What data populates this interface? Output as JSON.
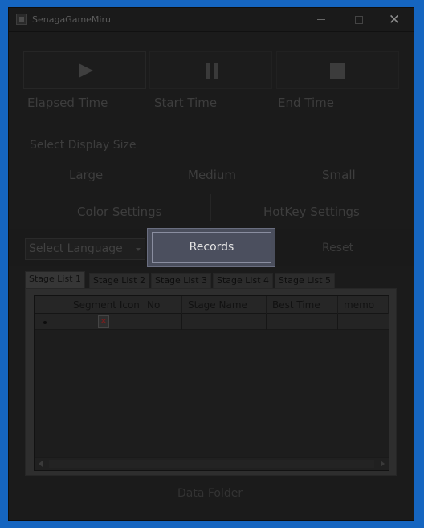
{
  "window": {
    "title": "SenagaGameMiru",
    "close_glyph": "✕"
  },
  "controls": {
    "play_icon": "play-icon",
    "pause_icon": "pause-icon",
    "stop_icon": "stop-icon"
  },
  "labels": {
    "elapsed_time": "Elapsed Time",
    "start_time": "Start Time",
    "end_time": "End Time",
    "select_display_size": "Select Display Size",
    "size_large": "Large",
    "size_medium": "Medium",
    "size_small": "Small",
    "color_settings": "Color Settings",
    "hotkey_settings": "HotKey Settings",
    "records": "Records",
    "reset": "Reset",
    "data_folder": "Data Folder"
  },
  "language": {
    "selected": "Select Language"
  },
  "tabs": [
    {
      "label": "Stage List 1",
      "active": true
    },
    {
      "label": "Stage List 2",
      "active": false
    },
    {
      "label": "Stage List 3",
      "active": false
    },
    {
      "label": "Stage List 4",
      "active": false
    },
    {
      "label": "Stage List 5",
      "active": false
    }
  ],
  "grid": {
    "columns": [
      "",
      "Segment Icon",
      "No",
      "Stage Name",
      "Best Time",
      "memo"
    ],
    "rows": [
      {
        "marker": "new-row-marker",
        "icon": "broken-image-icon",
        "no": "",
        "stage_name": "",
        "best_time": "",
        "memo": ""
      }
    ]
  },
  "colors": {
    "background": "#1565c0",
    "window": "#1b1b1b",
    "records_button": "#4a4e5c"
  }
}
